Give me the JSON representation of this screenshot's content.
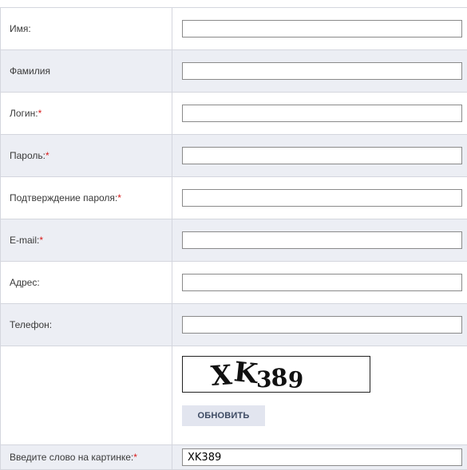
{
  "form": {
    "fields": [
      {
        "label": "Имя:",
        "required": "",
        "value": ""
      },
      {
        "label": "Фамилия",
        "required": "",
        "value": ""
      },
      {
        "label": "Логин:",
        "required": "*",
        "value": ""
      },
      {
        "label": "Пароль:",
        "required": "*",
        "value": ""
      },
      {
        "label": "Подтверждение пароля:",
        "required": "*",
        "value": ""
      },
      {
        "label": "E-mail:",
        "required": "*",
        "value": ""
      },
      {
        "label": "Адрес:",
        "required": "",
        "value": ""
      },
      {
        "label": "Телефон:",
        "required": "",
        "value": ""
      }
    ],
    "captcha": {
      "image_text": "XK389",
      "refresh_label": "ОБНОВИТЬ"
    },
    "captcha_input": {
      "label": "Введите слово на картинке:",
      "required": "*",
      "value": "XK389"
    }
  },
  "colors": {
    "required_marker": "#d81818",
    "alt_row_bg": "#eceef4",
    "button_bg": "#e2e5ef"
  }
}
